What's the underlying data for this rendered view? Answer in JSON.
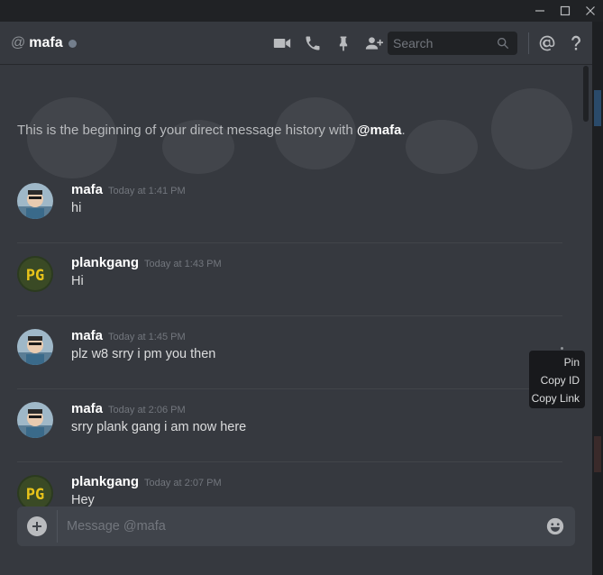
{
  "header": {
    "at": "@",
    "channel": "mafa",
    "search_placeholder": "Search",
    "icons": [
      "video-call-icon",
      "voice-call-icon",
      "pin-icon",
      "add-friend-icon",
      "mention-icon",
      "help-icon"
    ]
  },
  "intro": {
    "prefix": "This is the beginning of your direct message history with ",
    "handle": "@mafa",
    "suffix": "."
  },
  "messages": [
    {
      "user": "mafa",
      "time": "Today at 1:41 PM",
      "text": "hi",
      "avatar": "mafa"
    },
    {
      "user": "plankgang",
      "time": "Today at 1:43 PM",
      "text": "Hi",
      "avatar": "pg"
    },
    {
      "user": "mafa",
      "time": "Today at 1:45 PM",
      "text": "plz w8 srry i pm you then",
      "avatar": "mafa"
    },
    {
      "user": "mafa",
      "time": "Today at 2:06 PM",
      "text": "srry plank gang i am now here",
      "avatar": "mafa"
    },
    {
      "user": "plankgang",
      "time": "Today at 2:07 PM",
      "text": "Hey",
      "avatar": "pg"
    }
  ],
  "context_menu": {
    "items": [
      "Pin",
      "Copy ID",
      "Copy Link"
    ]
  },
  "composer": {
    "placeholder": "Message @mafa"
  },
  "colors": {
    "background": "#36393f",
    "chrome": "#202225",
    "status_offline": "#747f8d",
    "pg_avatar_bg": "#2b3a1f",
    "pg_avatar_text": "#e8c31a"
  }
}
